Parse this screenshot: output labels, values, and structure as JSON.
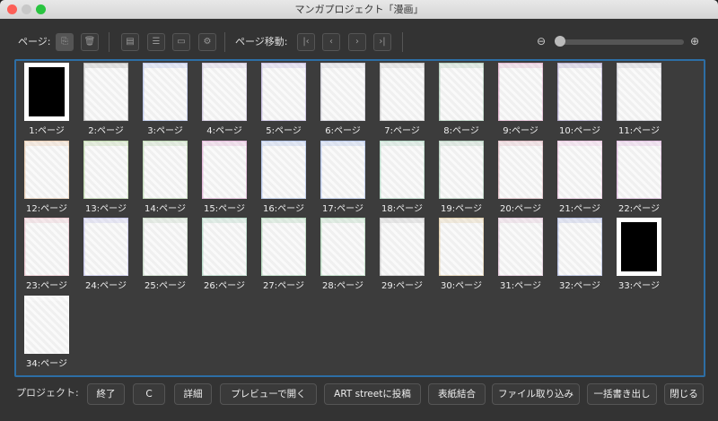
{
  "window": {
    "title": "マンガプロジェクト「漫画」"
  },
  "toolbar": {
    "page_label": "ページ:",
    "page_move_label": "ページ移動:",
    "zoom_slider_value": 0.0,
    "icons": [
      "add-page-icon",
      "trash-icon",
      "page-icon",
      "page-list-icon",
      "folder-icon",
      "folder-settings-icon",
      "first-page-icon",
      "prev-page-icon",
      "next-page-icon",
      "last-page-icon"
    ]
  },
  "pages": [
    {
      "label": "1:ページ",
      "tint": "#000000"
    },
    {
      "label": "2:ページ",
      "tint": "#888888"
    },
    {
      "label": "3:ページ",
      "tint": "#8aa0e0"
    },
    {
      "label": "4:ページ",
      "tint": "#b0a0c8"
    },
    {
      "label": "5:ページ",
      "tint": "#a090d0"
    },
    {
      "label": "6:ページ",
      "tint": "#b0b0c0"
    },
    {
      "label": "7:ページ",
      "tint": "#a0a0a0"
    },
    {
      "label": "8:ページ",
      "tint": "#80b090"
    },
    {
      "label": "9:ページ",
      "tint": "#d080b0"
    },
    {
      "label": "10:ページ",
      "tint": "#8070b0"
    },
    {
      "label": "11:ページ",
      "tint": "#a0a0b0"
    },
    {
      "label": "12:ページ",
      "tint": "#e0b080"
    },
    {
      "label": "13:ページ",
      "tint": "#90c070"
    },
    {
      "label": "14:ページ",
      "tint": "#90c080"
    },
    {
      "label": "15:ページ",
      "tint": "#d080c0"
    },
    {
      "label": "16:ページ",
      "tint": "#80a0e0"
    },
    {
      "label": "17:ページ",
      "tint": "#80a0e0"
    },
    {
      "label": "18:ページ",
      "tint": "#80c0a0"
    },
    {
      "label": "19:ページ",
      "tint": "#80b090"
    },
    {
      "label": "20:ページ",
      "tint": "#d090a0"
    },
    {
      "label": "21:ページ",
      "tint": "#e0a0d0"
    },
    {
      "label": "22:ページ",
      "tint": "#d090d0"
    },
    {
      "label": "23:ページ",
      "tint": "#e0a0b0"
    },
    {
      "label": "24:ページ",
      "tint": "#a0a0e0"
    },
    {
      "label": "25:ページ",
      "tint": "#a0c0a0"
    },
    {
      "label": "26:ページ",
      "tint": "#80c0a0"
    },
    {
      "label": "27:ページ",
      "tint": "#80c090"
    },
    {
      "label": "28:ページ",
      "tint": "#80c090"
    },
    {
      "label": "29:ページ",
      "tint": "#a0a0a0"
    },
    {
      "label": "30:ページ",
      "tint": "#d0b070"
    },
    {
      "label": "31:ページ",
      "tint": "#d0a0c0"
    },
    {
      "label": "32:ページ",
      "tint": "#8090d0"
    },
    {
      "label": "33:ページ",
      "tint": "#000000"
    },
    {
      "label": "34:ページ",
      "tint": "#ffffff"
    }
  ],
  "footer": {
    "project_label": "プロジェクト:",
    "buttons": [
      "終了",
      "C",
      "詳細",
      "プレビューで開く",
      "ART streetに投稿",
      "表紙結合",
      "ファイル取り込み",
      "一括書き出し",
      "閉じる"
    ]
  }
}
